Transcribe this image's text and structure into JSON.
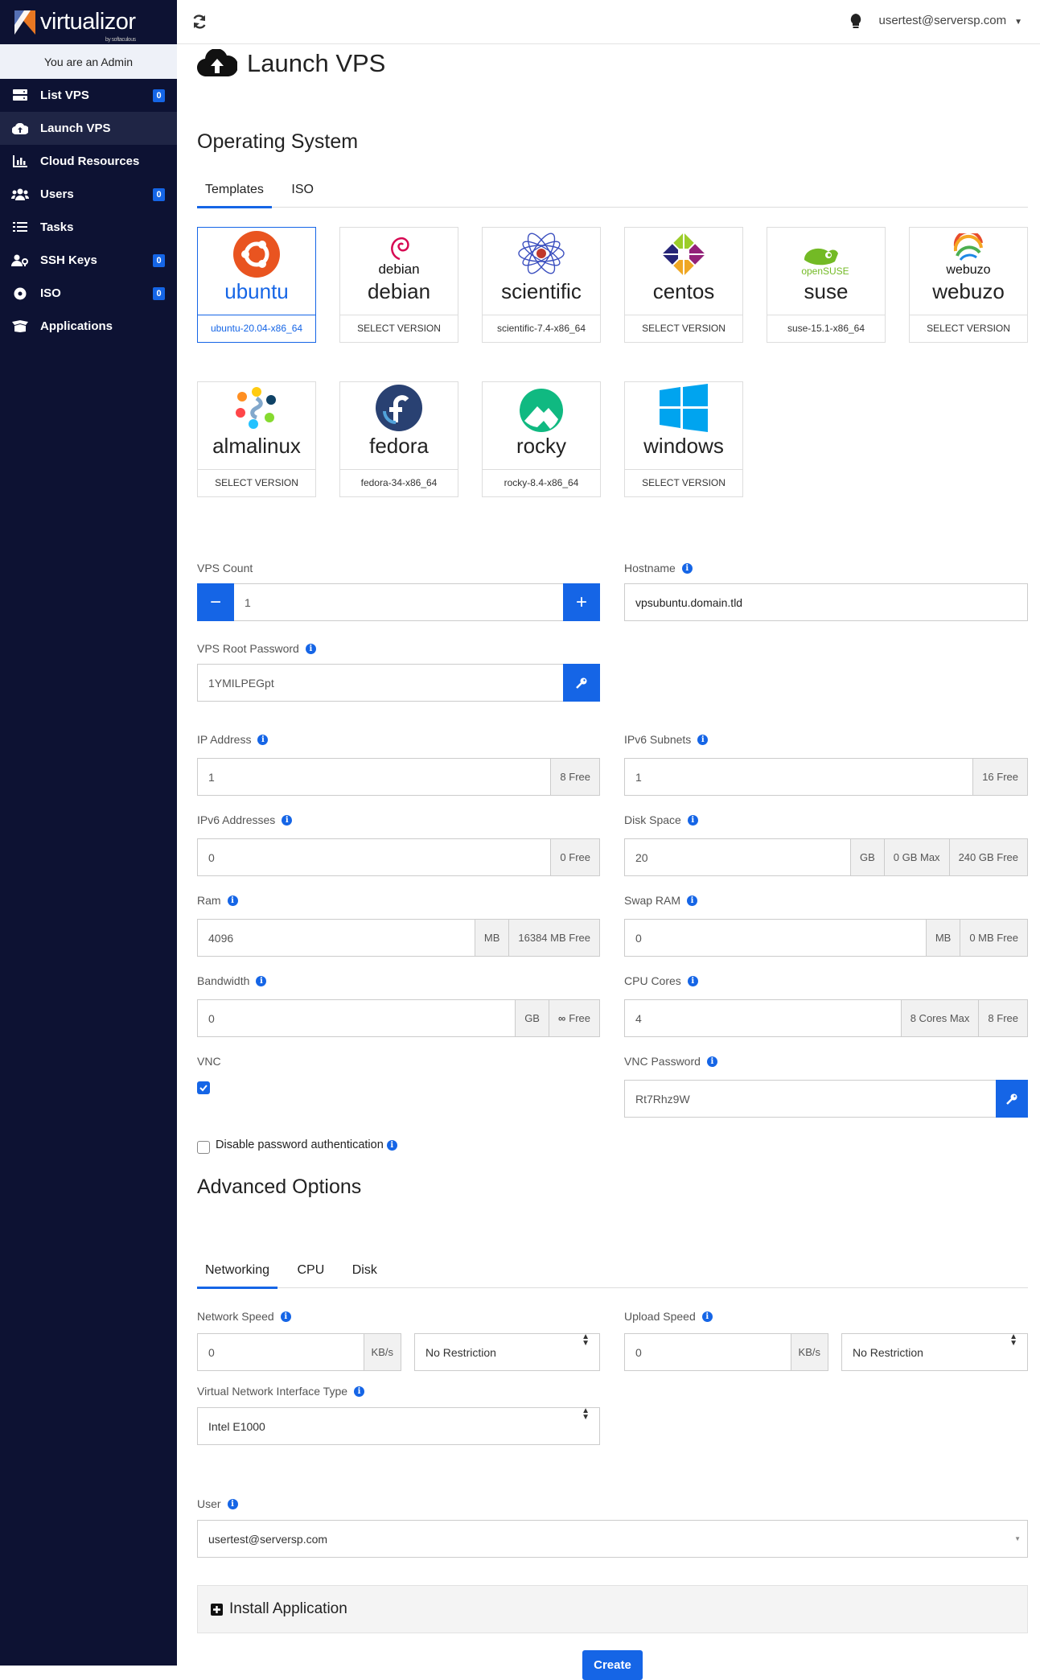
{
  "app": {
    "brand": "virtualizor",
    "brand_sub": "by softaculous",
    "admin_notice": "You are an Admin"
  },
  "sidebar": {
    "items": [
      {
        "label": "List VPS",
        "badge": "0",
        "icon": "server-icon"
      },
      {
        "label": "Launch VPS",
        "icon": "cloud-upload-icon"
      },
      {
        "label": "Cloud Resources",
        "icon": "chart-bar-icon"
      },
      {
        "label": "Users",
        "badge": "0",
        "icon": "users-icon"
      },
      {
        "label": "Tasks",
        "icon": "tasks-icon"
      },
      {
        "label": "SSH Keys",
        "badge": "0",
        "icon": "user-key-icon"
      },
      {
        "label": "ISO",
        "badge": "0",
        "icon": "disc-icon"
      },
      {
        "label": "Applications",
        "icon": "box-open-icon"
      }
    ]
  },
  "topbar": {
    "user": "usertest@serversp.com"
  },
  "page": {
    "title": "Launch VPS"
  },
  "os": {
    "heading": "Operating System",
    "tabs": [
      "Templates",
      "ISO"
    ],
    "templates": [
      {
        "name": "ubuntu",
        "version": "ubuntu-20.04-x86_64",
        "selected": true
      },
      {
        "name": "debian",
        "version": "SELECT VERSION"
      },
      {
        "name": "scientific",
        "version": "scientific-7.4-x86_64"
      },
      {
        "name": "centos",
        "version": "SELECT VERSION"
      },
      {
        "name": "suse",
        "version": "suse-15.1-x86_64"
      },
      {
        "name": "webuzo",
        "version": "SELECT VERSION"
      },
      {
        "name": "almalinux",
        "version": "SELECT VERSION"
      },
      {
        "name": "fedora",
        "version": "fedora-34-x86_64"
      },
      {
        "name": "rocky",
        "version": "rocky-8.4-x86_64"
      },
      {
        "name": "windows",
        "version": "SELECT VERSION"
      }
    ],
    "logo_text": {
      "debian": "debian",
      "suse": "openSUSE",
      "webuzo": "webuzo"
    }
  },
  "form": {
    "vps_count": {
      "label": "VPS Count",
      "value": "1"
    },
    "hostname": {
      "label": "Hostname",
      "value": "vpsubuntu.domain.tld"
    },
    "root_password": {
      "label": "VPS Root Password",
      "value": "1YMILPEGpt"
    },
    "ip_address": {
      "label": "IP Address",
      "value": "1",
      "free": "8 Free"
    },
    "ipv6_subnets": {
      "label": "IPv6 Subnets",
      "value": "1",
      "free": "16 Free"
    },
    "ipv6_addresses": {
      "label": "IPv6 Addresses",
      "value": "0",
      "free": "0 Free"
    },
    "disk_space": {
      "label": "Disk Space",
      "value": "20",
      "unit": "GB",
      "max": "0 GB Max",
      "free": "240 GB Free"
    },
    "ram": {
      "label": "Ram",
      "value": "4096",
      "unit": "MB",
      "free": "16384 MB Free"
    },
    "swap": {
      "label": "Swap RAM",
      "value": "0",
      "unit": "MB",
      "free": "0 MB Free"
    },
    "bandwidth": {
      "label": "Bandwidth",
      "value": "0",
      "unit": "GB",
      "free": "Free"
    },
    "cpu_cores": {
      "label": "CPU Cores",
      "value": "4",
      "max": "8 Cores Max",
      "free": "8 Free"
    },
    "vnc": {
      "label": "VNC",
      "checked": true
    },
    "vnc_password": {
      "label": "VNC Password",
      "value": "Rt7Rhz9W"
    },
    "disable_pw_auth": {
      "label": "Disable password authentication",
      "checked": false
    }
  },
  "advanced": {
    "heading": "Advanced Options",
    "tabs": [
      "Networking",
      "CPU",
      "Disk"
    ],
    "network_speed": {
      "label": "Network Speed",
      "value": "0",
      "unit": "KB/s",
      "select": "No Restriction"
    },
    "upload_speed": {
      "label": "Upload Speed",
      "value": "0",
      "unit": "KB/s",
      "select": "No Restriction"
    },
    "vnic": {
      "label": "Virtual Network Interface Type",
      "select": "Intel E1000"
    },
    "user": {
      "label": "User",
      "select": "usertest@serversp.com"
    },
    "install_app": "Install Application",
    "create": "Create"
  },
  "colors": {
    "accent": "#1565e6",
    "sidebar": "#0d1233"
  }
}
